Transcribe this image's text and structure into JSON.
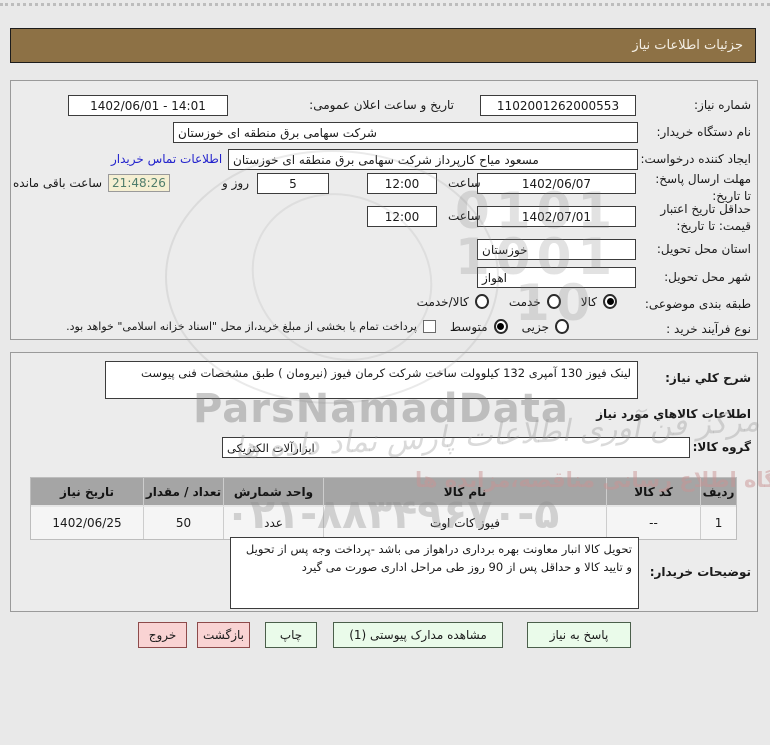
{
  "title_bar": {
    "text": "جزئیات اطلاعات نیاز"
  },
  "form1": {
    "need_number": {
      "label": "شماره نیاز:",
      "value": "1102001262000553"
    },
    "announce": {
      "label": "تاریخ و ساعت اعلان عمومی:",
      "value": "1402/06/01 - 14:01"
    },
    "buyer_org": {
      "label": "نام دستگاه خریدار:",
      "value": "شرکت سهامی برق منطقه ای خوزستان"
    },
    "creator": {
      "label": "ایجاد کننده درخواست:",
      "value": "مسعود میاح کارپرداز شرکت سهامی برق منطقه ای خوزستان",
      "contact_link": "اطلاعات تماس خریدار"
    },
    "deadline": {
      "label": "مهلت ارسال پاسخ: تا تاریخ:",
      "date": "1402/06/07",
      "hour_label": "ساعت",
      "time": "12:00",
      "days": "5",
      "days_label": "روز و",
      "countdown": "21:48:26",
      "remaining_label": "ساعت باقی مانده"
    },
    "validity": {
      "label": "حداقل تاریخ اعتبار قیمت: تا تاریخ:",
      "date": "1402/07/01",
      "hour_label": "ساعت",
      "time": "12:00"
    },
    "province": {
      "label": "استان محل تحویل:",
      "value": "خوزستان"
    },
    "city": {
      "label": "شهر محل تحویل:",
      "value": "اهواز"
    },
    "classification": {
      "label": "طبقه بندی موضوعی:",
      "options": [
        {
          "label": "کالا",
          "selected": true
        },
        {
          "label": "خدمت",
          "selected": false
        },
        {
          "label": "کالا/خدمت",
          "selected": false
        }
      ]
    },
    "process": {
      "label": "نوع فرآیند خرید :",
      "options": [
        {
          "label": "جزیی",
          "selected": false
        },
        {
          "label": "متوسط",
          "selected": true
        }
      ],
      "treasury_note": "پرداخت تمام یا بخشی از مبلغ خرید،از محل \"اسناد خزانه اسلامی\" خواهد بود."
    }
  },
  "form2": {
    "description": {
      "label": "شرح کلي نیاز:",
      "value": "لینک فیوز 130 آمپری 132 کیلوولت ساخت شرکت کرمان فیوز (نیرومان ) طبق مشخصات فنی پیوست"
    },
    "goods_section_title": "اطلاعات کالاهاي مورد نیاز",
    "goods_group": {
      "label": "گروه کالا:",
      "value": "ابزارآلات الکتریکی"
    },
    "table": {
      "headers": [
        "ردیف",
        "کد کالا",
        "نام کالا",
        "واحد شمارش",
        "تعداد / مقدار",
        "تاریخ نیاز"
      ],
      "rows": [
        {
          "row": "1",
          "code": "--",
          "name": "فیوز کات اوت",
          "unit": "عدد",
          "qty": "50",
          "date": "1402/06/25"
        }
      ]
    },
    "buyer_notes": {
      "label": "توضیحات خریدار:",
      "value": "تحویل کالا انبار معاونت بهره برداری دراهواز می باشد -پرداخت وجه پس از تحویل و تایید کالا و حداقل پس از 90 روز طی مراحل اداری صورت می گیرد"
    }
  },
  "buttons": {
    "respond": "پاسخ به نیاز",
    "view_attachments": "مشاهده مدارک پیوستی (1)",
    "print": "چاپ",
    "back": "بازگشت",
    "exit": "خروج"
  },
  "watermark": {
    "brand_latin": "ParsNamadData",
    "brand_persian": "مرکز فن آوری اطلاعات پارس نماد داده ها",
    "portal_line": "پایگاه اطلاع رسانی مناقصه،مزایده ها",
    "phone": "۰۲۱-۸۸۳۴۹۶۷۰-۵",
    "emblem_lines": [
      "0101",
      "1001",
      "10"
    ]
  },
  "colors": {
    "title_bar_bg": "#8d7145",
    "countdown_bg": "#f5efd2",
    "countdown_text": "#4f7d6b",
    "link": "#2222cc",
    "button_green_bg": "#eafbea",
    "button_pink_bg": "#f9d3d3"
  }
}
